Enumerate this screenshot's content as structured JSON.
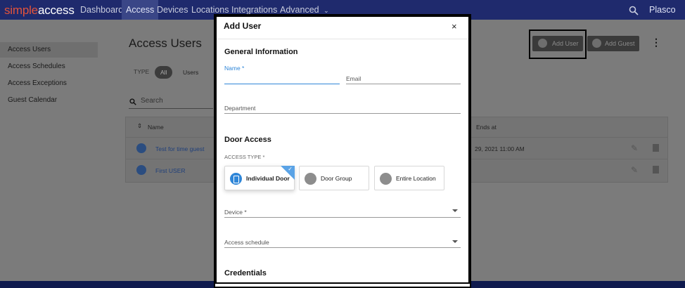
{
  "brand": {
    "simple": "simple",
    "access": "access"
  },
  "nav": {
    "items": [
      "Dashboard",
      "Access",
      "Devices",
      "Locations",
      "Integrations",
      "Advanced"
    ],
    "user": "Plasco"
  },
  "sidebar": {
    "items": [
      "Access Users",
      "Access Schedules",
      "Access Exceptions",
      "Guest Calendar"
    ]
  },
  "main": {
    "title": "Access Users",
    "type_label": "TYPE",
    "filters": [
      "All",
      "Users"
    ],
    "search_placeholder": "Search",
    "buttons": {
      "add_user": "Add User",
      "add_guest": "Add Guest"
    },
    "table": {
      "headers": [
        "Name",
        "Ends at"
      ],
      "rows": [
        {
          "name": "Test for time guest",
          "ends_at": "29, 2021 11:00 AM"
        },
        {
          "name": "First USER",
          "ends_at": ""
        }
      ]
    }
  },
  "modal": {
    "title": "Add User",
    "close": "×",
    "general_section": "General Information",
    "name_label": "Name *",
    "email_label": "Email",
    "department_label": "Department",
    "door_section": "Door Access",
    "access_type_label": "ACCESS TYPE *",
    "access_types": [
      "Individual Door",
      "Door Group",
      "Entire Location"
    ],
    "device_label": "Device *",
    "schedule_label": "Access schedule",
    "credentials_section": "Credentials"
  },
  "colors": {
    "topbar": "#1f2a6d",
    "accent": "#2f86d8",
    "brand_red": "#e2533b"
  }
}
